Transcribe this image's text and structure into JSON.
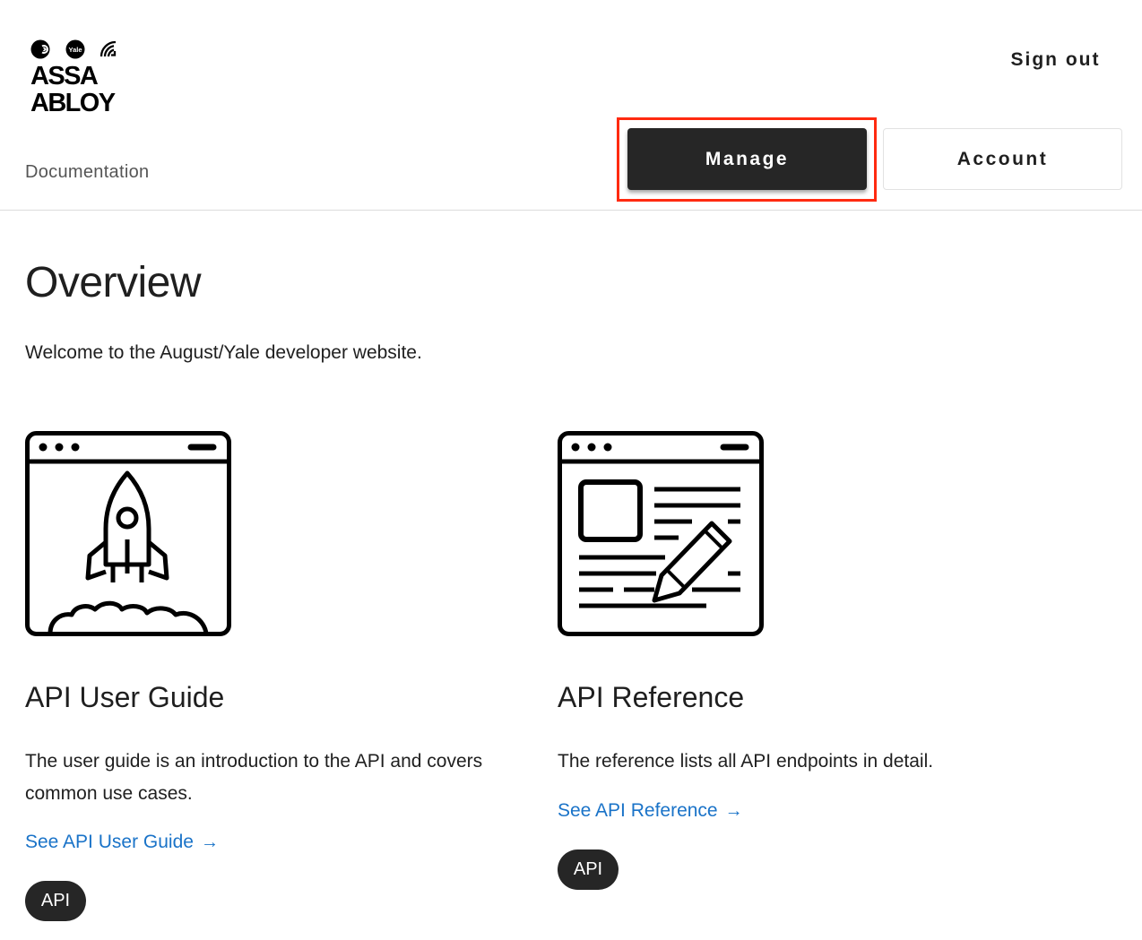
{
  "header": {
    "logo_text": "ASSA ABLOY",
    "logo_badge": "Yale",
    "sign_out_label": "Sign out",
    "nav_documentation": "Documentation",
    "tabs": [
      {
        "label": "Manage",
        "active": true
      },
      {
        "label": "Account",
        "active": false
      }
    ]
  },
  "main": {
    "title": "Overview",
    "welcome": "Welcome to the August/Yale developer website.",
    "cards": [
      {
        "icon": "rocket-browser-icon",
        "title": "API User Guide",
        "description": "The user guide is an introduction to the API and covers common use cases.",
        "link_label": "See API User Guide",
        "tag": "API"
      },
      {
        "icon": "document-edit-browser-icon",
        "title": "API Reference",
        "description": "The reference lists all API endpoints in detail.",
        "link_label": "See API Reference",
        "tag": "API"
      }
    ]
  },
  "colors": {
    "accent_link": "#1a73c8",
    "dark_button": "#262626",
    "highlight_outline": "#ff2a10"
  }
}
